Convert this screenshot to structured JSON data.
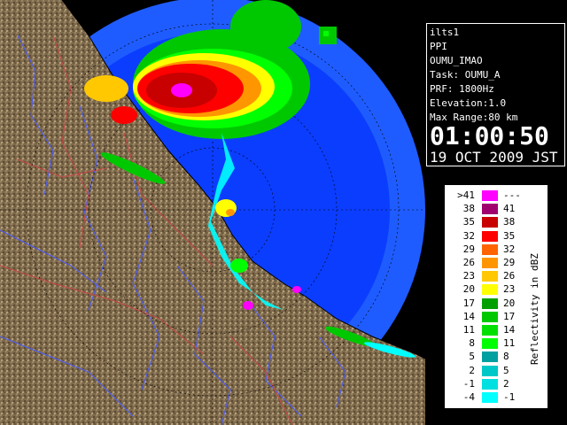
{
  "info_panel": {
    "station": "ilts1",
    "product": "PPI",
    "site": "OUMU_IMAO",
    "task": "Task: OUMU_A",
    "prf": "PRF: 1800Hz",
    "elevation": "Elevation:1.0",
    "max_range": "Max Range:80 km",
    "time": "01:00:50",
    "date": "19 OCT 2009 JST"
  },
  "legend": {
    "title": "Reflectivity in dBZ",
    "rows": [
      {
        "lower": ">41",
        "upper": "---",
        "color": "#ff00ff"
      },
      {
        "lower": "38",
        "upper": "41",
        "color": "#a0006e"
      },
      {
        "lower": "35",
        "upper": "38",
        "color": "#c80000"
      },
      {
        "lower": "32",
        "upper": "35",
        "color": "#ff0000"
      },
      {
        "lower": "29",
        "upper": "32",
        "color": "#ff6400"
      },
      {
        "lower": "26",
        "upper": "29",
        "color": "#ff9600"
      },
      {
        "lower": "23",
        "upper": "26",
        "color": "#ffc800"
      },
      {
        "lower": "20",
        "upper": "23",
        "color": "#ffff00"
      },
      {
        "lower": "17",
        "upper": "20",
        "color": "#00a000"
      },
      {
        "lower": "14",
        "upper": "17",
        "color": "#00c800"
      },
      {
        "lower": "11",
        "upper": "14",
        "color": "#00e000"
      },
      {
        "lower": "8",
        "upper": "11",
        "color": "#00ff00"
      },
      {
        "lower": "5",
        "upper": "8",
        "color": "#00a0a0"
      },
      {
        "lower": "2",
        "upper": "5",
        "color": "#00c8c8"
      },
      {
        "lower": "-1",
        "upper": "2",
        "color": "#00e0e0"
      },
      {
        "lower": "-4",
        "upper": "-1",
        "color": "#00ffff"
      }
    ]
  },
  "colors": {
    "sea_blue": "#0a3cff",
    "range_outer": "#1a5aff",
    "land": "#7a6548",
    "rivers": "#4a5aff",
    "borders": "#c04040"
  }
}
